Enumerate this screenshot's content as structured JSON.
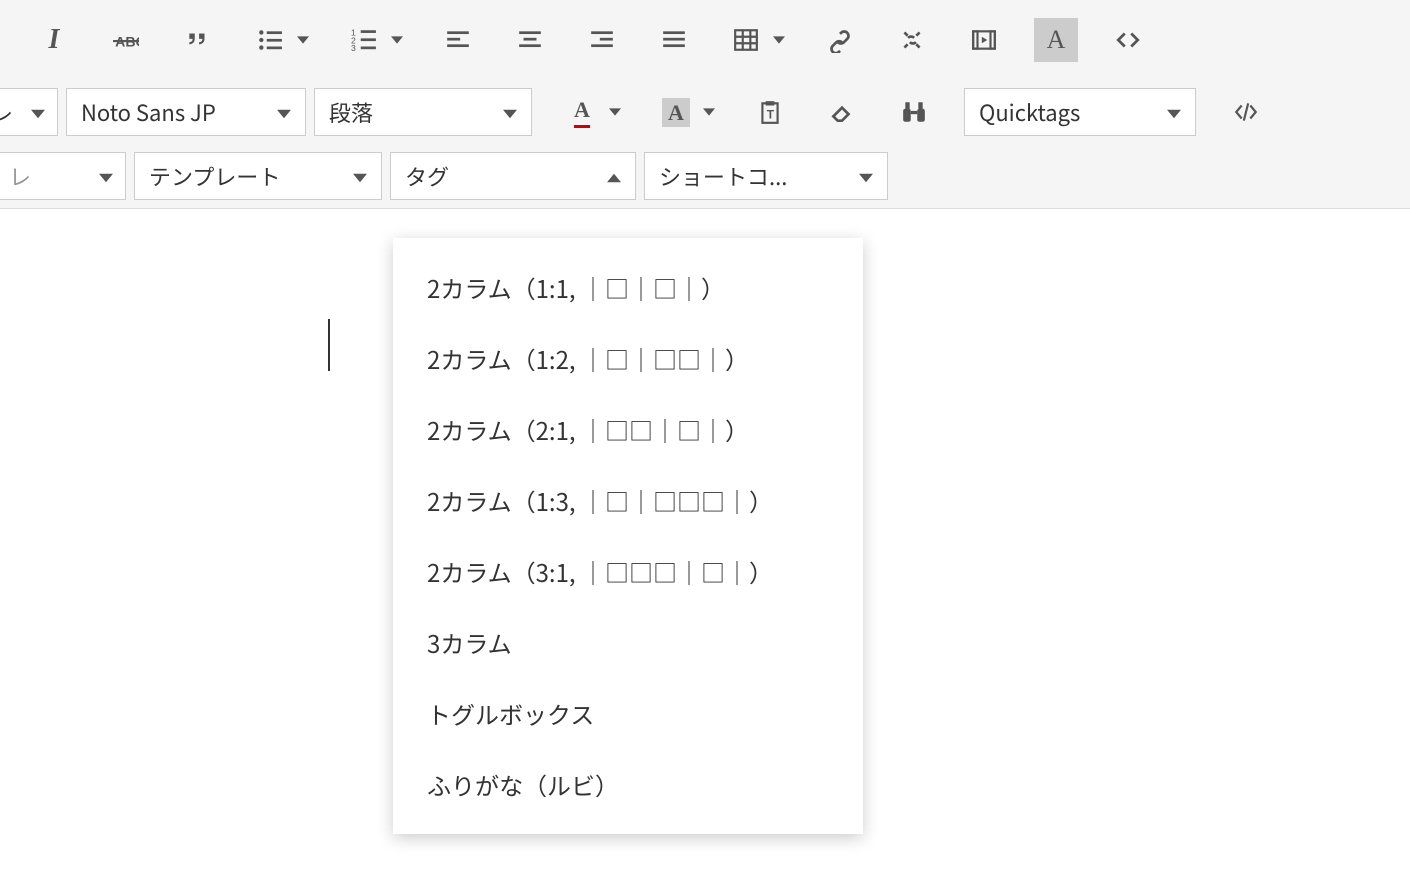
{
  "toolbar_row1": {
    "italic_glyph": "I",
    "clear_format_tooltip": "clear-format"
  },
  "toolbar_row2": {
    "partial_select_glyph": "レ",
    "font_family_label": "Noto Sans JP",
    "format_select_label": "段落",
    "text_color_glyph": "A",
    "bg_color_glyph": "A",
    "quicktags_label": "Quicktags"
  },
  "toolbar_row3": {
    "partial_select_glyph": "レ",
    "template_label": "テンプレート",
    "tag_label": "タグ",
    "shortcode_label": "ショートコ..."
  },
  "tag_dropdown": {
    "items": [
      "2カラム（1:1, ｜□｜□｜）",
      "2カラム（1:2, ｜□｜□□｜）",
      "2カラム（2:1, ｜□□｜□｜）",
      "2カラム（1:3, ｜□｜□□□｜）",
      "2カラム（3:1, ｜□□□｜□｜）",
      "3カラム",
      "トグルボックス",
      "ふりがな（ルビ）"
    ]
  }
}
